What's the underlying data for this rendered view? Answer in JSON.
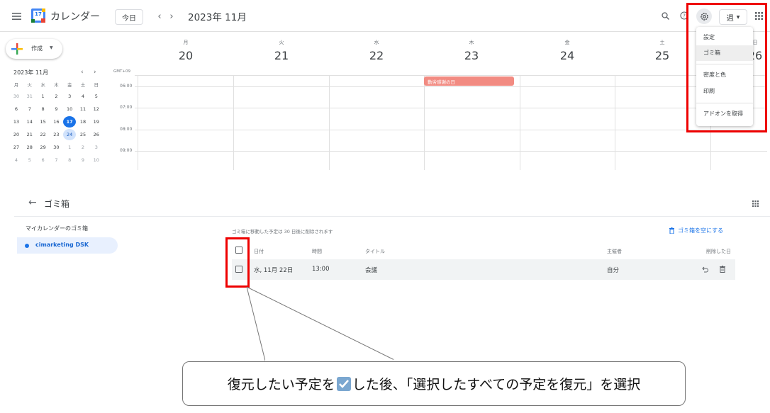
{
  "app": {
    "title": "カレンダー",
    "logo_day": "17"
  },
  "toolbar": {
    "today_label": "今日",
    "prev_icon": "chevron-left",
    "next_icon": "chevron-right",
    "period": "2023年 11月",
    "view_label": "週"
  },
  "create": {
    "label": "作成"
  },
  "week": {
    "days": [
      {
        "name": "月",
        "num": "20"
      },
      {
        "name": "火",
        "num": "21"
      },
      {
        "name": "水",
        "num": "22"
      },
      {
        "name": "木",
        "num": "23"
      },
      {
        "name": "金",
        "num": "24"
      },
      {
        "name": "土",
        "num": "25"
      },
      {
        "name": "日",
        "num": "26"
      }
    ],
    "timezone": "GMT+09",
    "times": [
      "06:00",
      "07:00",
      "08:00",
      "09:00"
    ],
    "event": {
      "title": "勤労感謝の日",
      "color": "#f28b82"
    }
  },
  "mini_calendar": {
    "month": "2023年 11月",
    "weekdays": [
      "月",
      "火",
      "水",
      "木",
      "金",
      "土",
      "日"
    ],
    "weeks": [
      [
        "30",
        "31",
        "1",
        "2",
        "3",
        "4",
        "5"
      ],
      [
        "6",
        "7",
        "8",
        "9",
        "10",
        "11",
        "12"
      ],
      [
        "13",
        "14",
        "15",
        "16",
        "17",
        "18",
        "19"
      ],
      [
        "20",
        "21",
        "22",
        "23",
        "24",
        "25",
        "26"
      ],
      [
        "27",
        "28",
        "29",
        "30",
        "1",
        "2",
        "3"
      ],
      [
        "4",
        "5",
        "6",
        "7",
        "8",
        "9",
        "10"
      ]
    ],
    "today": "17",
    "selected": "24"
  },
  "settings_menu": {
    "items": [
      "設定",
      "ゴミ箱",
      "密度と色",
      "印刷",
      "アドオンを取得"
    ]
  },
  "trash": {
    "title": "ゴミ箱",
    "sidebar_heading": "マイカレンダーのゴミ箱",
    "calendar_name": "cimarketing DSK",
    "calendar_color": "#1a73e8",
    "notice": "ゴミ箱に移動した予定は 30 日後に削除されます",
    "empty_label": "ゴミ箱を空にする",
    "columns": {
      "date": "日付",
      "time": "時間",
      "title": "タイトル",
      "organizer": "主催者",
      "deleted": "削除した日"
    },
    "rows": [
      {
        "date": "水, 11月 22日",
        "time": "13:00",
        "title": "会議",
        "organizer": "自分"
      }
    ]
  },
  "callout": {
    "text_before": "復元したい予定を",
    "text_after": "した後、「選択したすべての予定を復元」を選択"
  },
  "colors": {
    "accent": "#1a73e8",
    "highlight": "#ee0000"
  }
}
